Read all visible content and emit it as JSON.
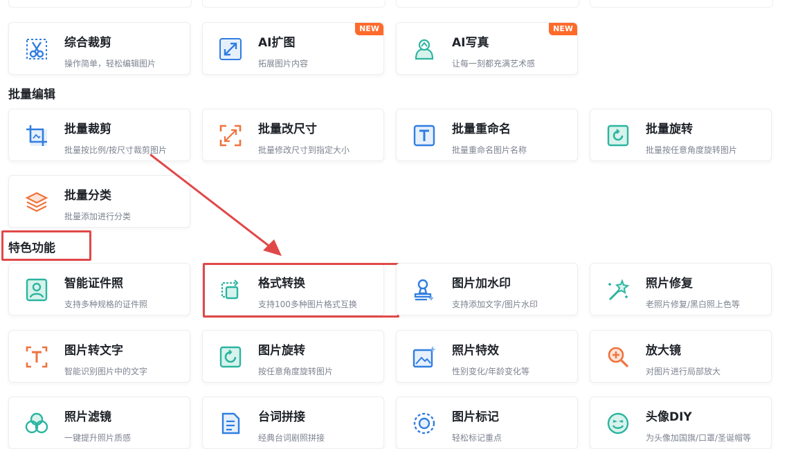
{
  "sections": [
    {
      "id": "ai",
      "title": ""
    },
    {
      "id": "batch",
      "title": "批量编辑"
    },
    {
      "id": "featured",
      "title": "特色功能"
    }
  ],
  "cards": {
    "crop": {
      "title": "综合裁剪",
      "desc": "操作简单，轻松编辑图片",
      "icon": "scissors-crop-icon"
    },
    "ai_expand": {
      "title": "AI扩图",
      "desc": "拓展图片内容",
      "icon": "expand-arrows-icon",
      "badge": "NEW"
    },
    "ai_portrait": {
      "title": "AI写真",
      "desc": "让每一刻都充满艺术感",
      "icon": "portrait-silhouette-icon",
      "badge": "NEW"
    },
    "batch_crop": {
      "title": "批量裁剪",
      "desc": "批量按比例/按尺寸裁剪图片",
      "icon": "batch-crop-icon"
    },
    "batch_resize": {
      "title": "批量改尺寸",
      "desc": "批量修改尺寸到指定大小",
      "icon": "resize-corners-icon"
    },
    "batch_rename": {
      "title": "批量重命名",
      "desc": "批量重命名图片名称",
      "icon": "text-t-icon"
    },
    "batch_rotate": {
      "title": "批量旋转",
      "desc": "批量按任意角度旋转图片",
      "icon": "rotate-icon"
    },
    "batch_classify": {
      "title": "批量分类",
      "desc": "批量添加进行分类",
      "icon": "layers-icon"
    },
    "id_photo": {
      "title": "智能证件照",
      "desc": "支持多种规格的证件照",
      "icon": "id-photo-icon"
    },
    "format": {
      "title": "格式转换",
      "desc": "支持100多种图片格式互换",
      "icon": "format-convert-icon"
    },
    "watermark": {
      "title": "图片加水印",
      "desc": "支持添加文字/图片水印",
      "icon": "watermark-stamp-icon"
    },
    "restore": {
      "title": "照片修复",
      "desc": "老照片修复/黑白照上色等",
      "icon": "magic-wand-icon"
    },
    "ocr": {
      "title": "图片转文字",
      "desc": "智能识别图片中的文字",
      "icon": "ocr-text-icon"
    },
    "rotate": {
      "title": "图片旋转",
      "desc": "按任意角度旋转图片",
      "icon": "rotate-circle-icon"
    },
    "effects": {
      "title": "照片特效",
      "desc": "性别变化/年龄变化等",
      "icon": "image-sparkle-icon"
    },
    "magnifier": {
      "title": "放大镜",
      "desc": "对图片进行局部放大",
      "icon": "magnifier-icon"
    },
    "filter": {
      "title": "照片滤镜",
      "desc": "一键提升照片质感",
      "icon": "filter-circles-icon"
    },
    "lines": {
      "title": "台词拼接",
      "desc": "经典台词剧照拼接",
      "icon": "document-stitch-icon"
    },
    "mark": {
      "title": "图片标记",
      "desc": "轻松标记重点",
      "icon": "target-mark-icon"
    },
    "avatar": {
      "title": "头像DIY",
      "desc": "为头像加国旗/口罩/圣诞帽等",
      "icon": "smiley-face-icon"
    }
  },
  "colors": {
    "accent_blue": "#2f7de1",
    "teal": "#2bb5a0",
    "orange": "#f0723c",
    "badge": "#ff6a2b",
    "highlight_red": "#e04848"
  }
}
